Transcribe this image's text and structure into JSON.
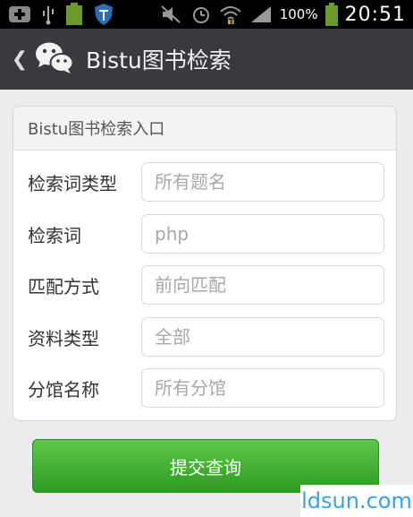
{
  "status_bar": {
    "battery_percent": "100%",
    "signal_percent": "100%",
    "time": "20:51"
  },
  "app_bar": {
    "title": "Bistu图书检索"
  },
  "form": {
    "header": "Bistu图书检索入口",
    "rows": [
      {
        "label": "检索词类型",
        "value": "",
        "placeholder": "所有题名"
      },
      {
        "label": "检索词",
        "value": "php",
        "placeholder": ""
      },
      {
        "label": "匹配方式",
        "value": "",
        "placeholder": "前向匹配"
      },
      {
        "label": "资料类型",
        "value": "",
        "placeholder": "全部"
      },
      {
        "label": "分馆名称",
        "value": "",
        "placeholder": "所有分馆"
      }
    ]
  },
  "submit_label": "提交查询",
  "watermark_text": "ldsun.com"
}
